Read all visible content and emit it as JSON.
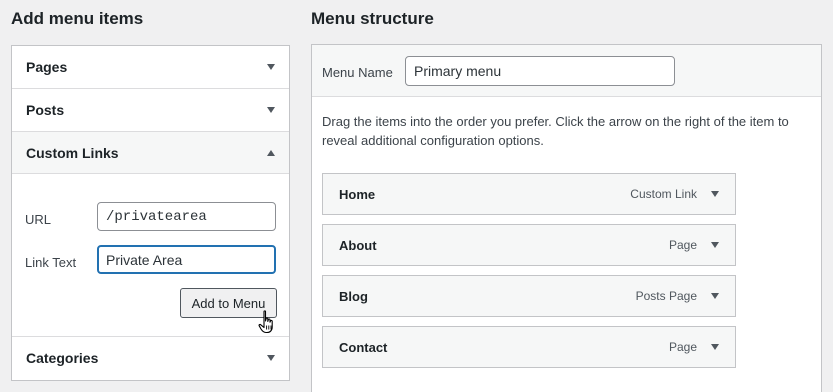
{
  "left": {
    "title": "Add menu items",
    "sections": [
      {
        "label": "Pages"
      },
      {
        "label": "Posts"
      },
      {
        "label": "Custom Links"
      },
      {
        "label": "Categories"
      }
    ],
    "custom_links": {
      "url_label": "URL",
      "url_value": "/privatearea",
      "link_text_label": "Link Text",
      "link_text_value": "Private Area",
      "add_button": "Add to Menu"
    }
  },
  "right": {
    "title": "Menu structure",
    "menu_name_label": "Menu Name",
    "menu_name_value": "Primary menu",
    "instructions": "Drag the items into the order you prefer. Click the arrow on the right of the item to reveal additional configuration options.",
    "items": [
      {
        "title": "Home",
        "type": "Custom Link"
      },
      {
        "title": "About",
        "type": "Page"
      },
      {
        "title": "Blog",
        "type": "Posts Page"
      },
      {
        "title": "Contact",
        "type": "Page"
      }
    ]
  },
  "icons": {
    "collapsed": "triangle-down-icon",
    "expanded": "triangle-up-icon",
    "pointer": "hand-pointer-cursor-icon"
  }
}
